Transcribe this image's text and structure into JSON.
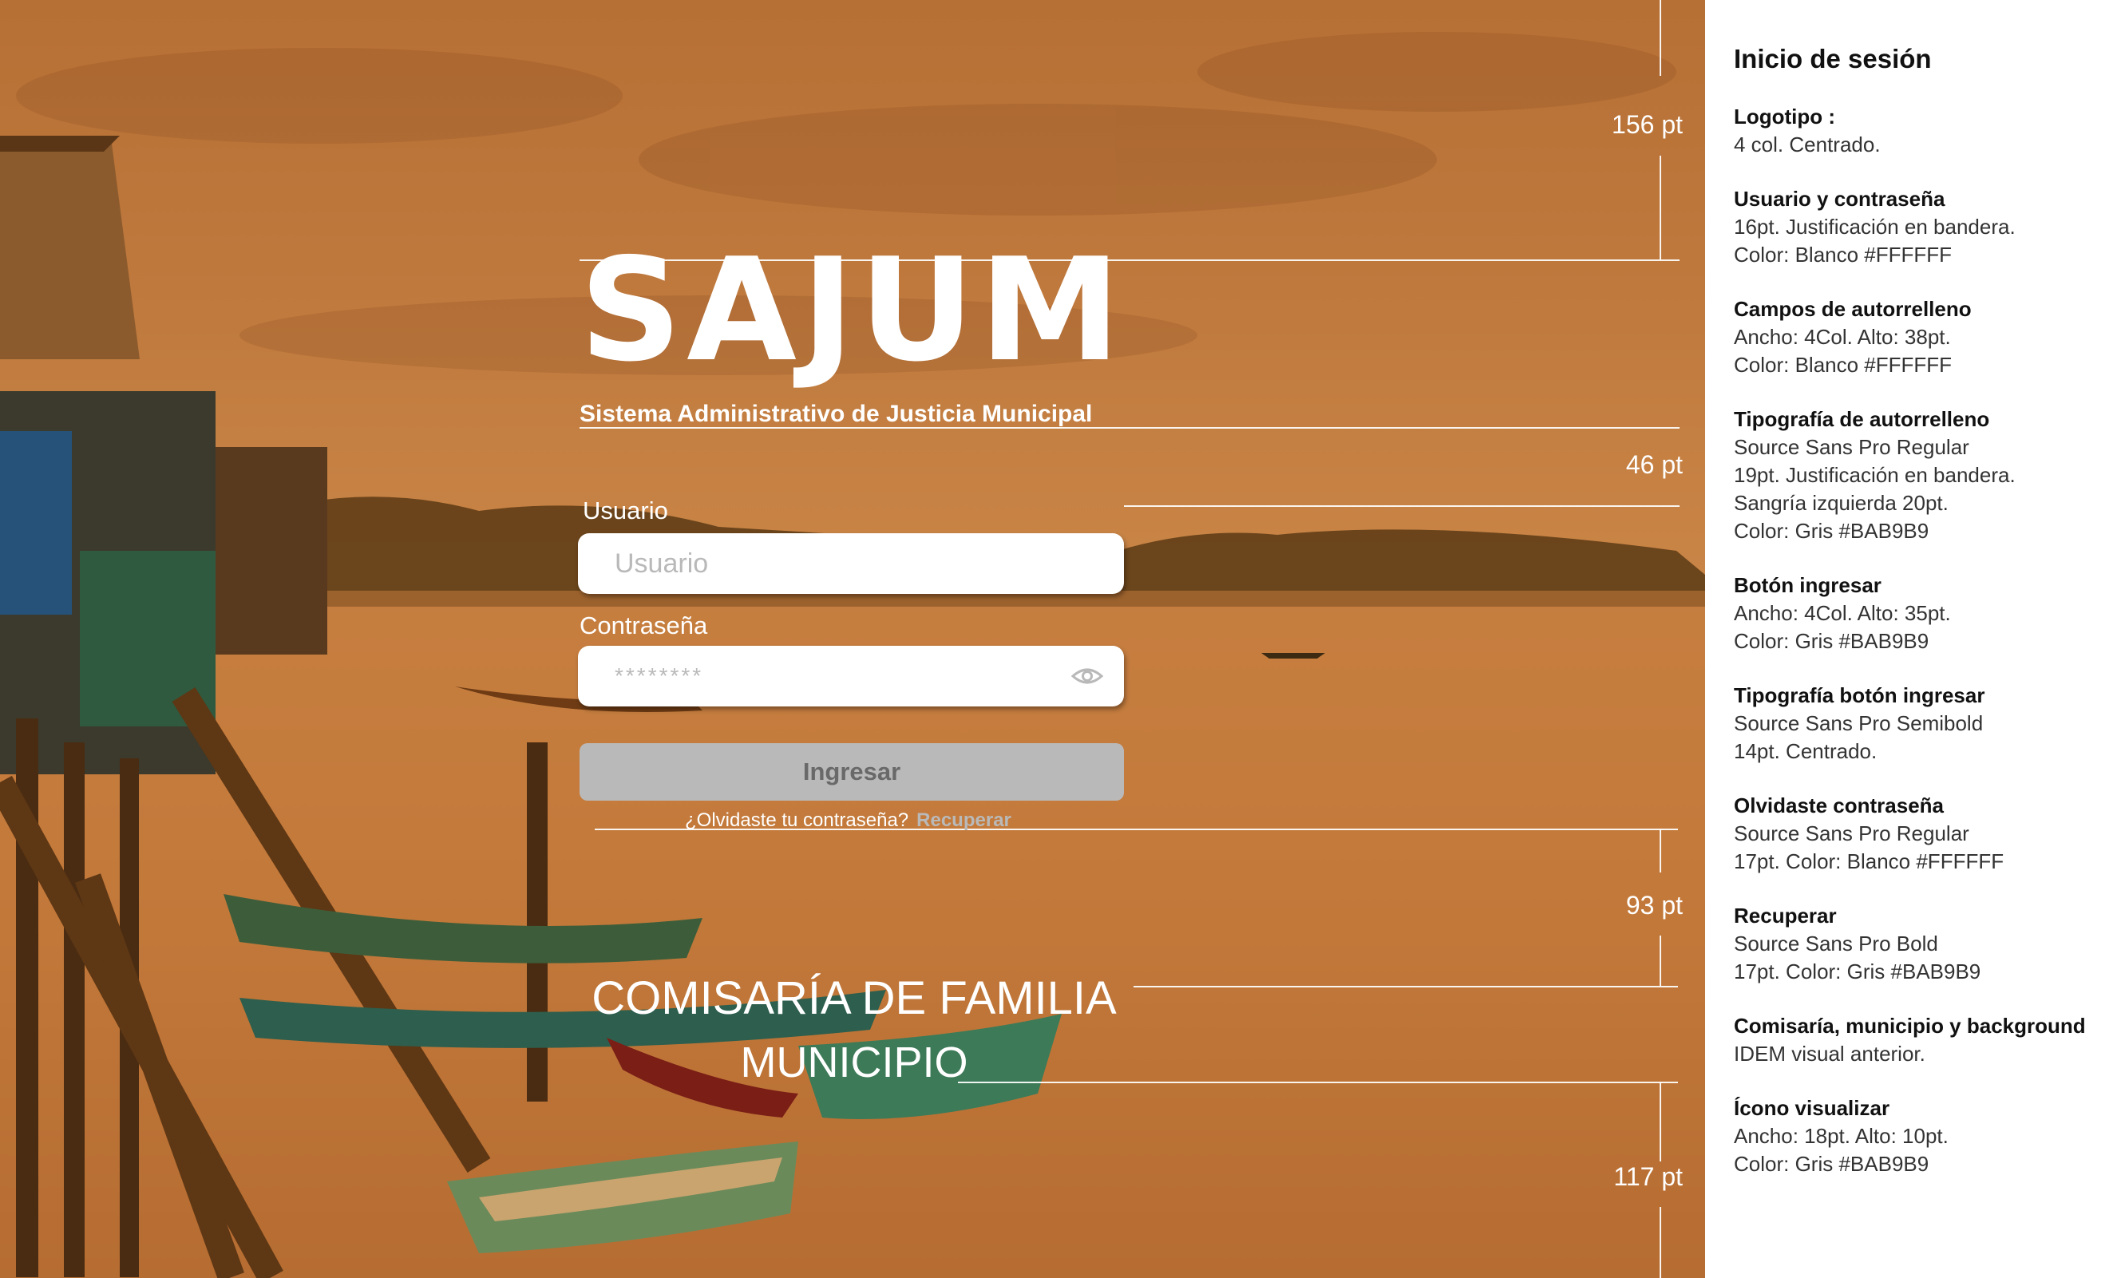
{
  "brand": {
    "logo_text": "SAJUM",
    "subtitle": "Sistema Administrativo de Justicia Municipal"
  },
  "form": {
    "username_label": "Usuario",
    "username_placeholder": "Usuario",
    "password_label": "Contraseña",
    "password_value": "********",
    "login_button": "Ingresar",
    "forgot_text": "¿Olvidaste tu contraseña?",
    "recover_link": "Recuperar",
    "eye_icon": "eye-icon"
  },
  "footer": {
    "commissary": "COMISARÍA DE FAMILIA",
    "municipality": "MUNICIPIO"
  },
  "measurements": [
    "156 pt",
    "46 pt",
    "93 pt",
    "117 pt"
  ],
  "specs": {
    "title": "Inicio de sesión",
    "sections": [
      {
        "title": "Logotipo :",
        "lines": [
          "4 col. Centrado."
        ]
      },
      {
        "title": "Usuario y contraseña",
        "lines": [
          "16pt. Justificación en bandera.",
          "Color: Blanco #FFFFFF"
        ]
      },
      {
        "title": "Campos de autorrelleno",
        "lines": [
          "Ancho: 4Col. Alto: 38pt.",
          "Color: Blanco #FFFFFF"
        ]
      },
      {
        "title": "Tipografía de autorrelleno",
        "lines": [
          "Source Sans Pro Regular",
          "19pt. Justificación en bandera.",
          "Sangría izquierda 20pt.",
          "Color: Gris #BAB9B9"
        ]
      },
      {
        "title": "Botón ingresar",
        "lines": [
          "Ancho: 4Col. Alto: 35pt.",
          "Color: Gris #BAB9B9"
        ]
      },
      {
        "title": "Tipografía botón ingresar",
        "lines": [
          "Source Sans Pro Semibold",
          "14pt. Centrado."
        ]
      },
      {
        "title": "Olvidaste contraseña",
        "lines": [
          "Source Sans Pro Regular",
          "17pt. Color: Blanco #FFFFFF"
        ]
      },
      {
        "title": "Recuperar",
        "lines": [
          "Source Sans Pro Bold",
          "17pt. Color: Gris #BAB9B9"
        ]
      },
      {
        "title": "Comisaría, municipio y background",
        "lines": [
          "IDEM visual anterior."
        ]
      },
      {
        "title": "Ícono visualizar",
        "lines": [
          "Ancho: 18pt. Alto: 10pt.",
          "Color: Gris #BAB9B9"
        ]
      }
    ]
  },
  "colors": {
    "white": "#FFFFFF",
    "gray": "#BAB9B9",
    "background_tint": "#C07A3E"
  }
}
